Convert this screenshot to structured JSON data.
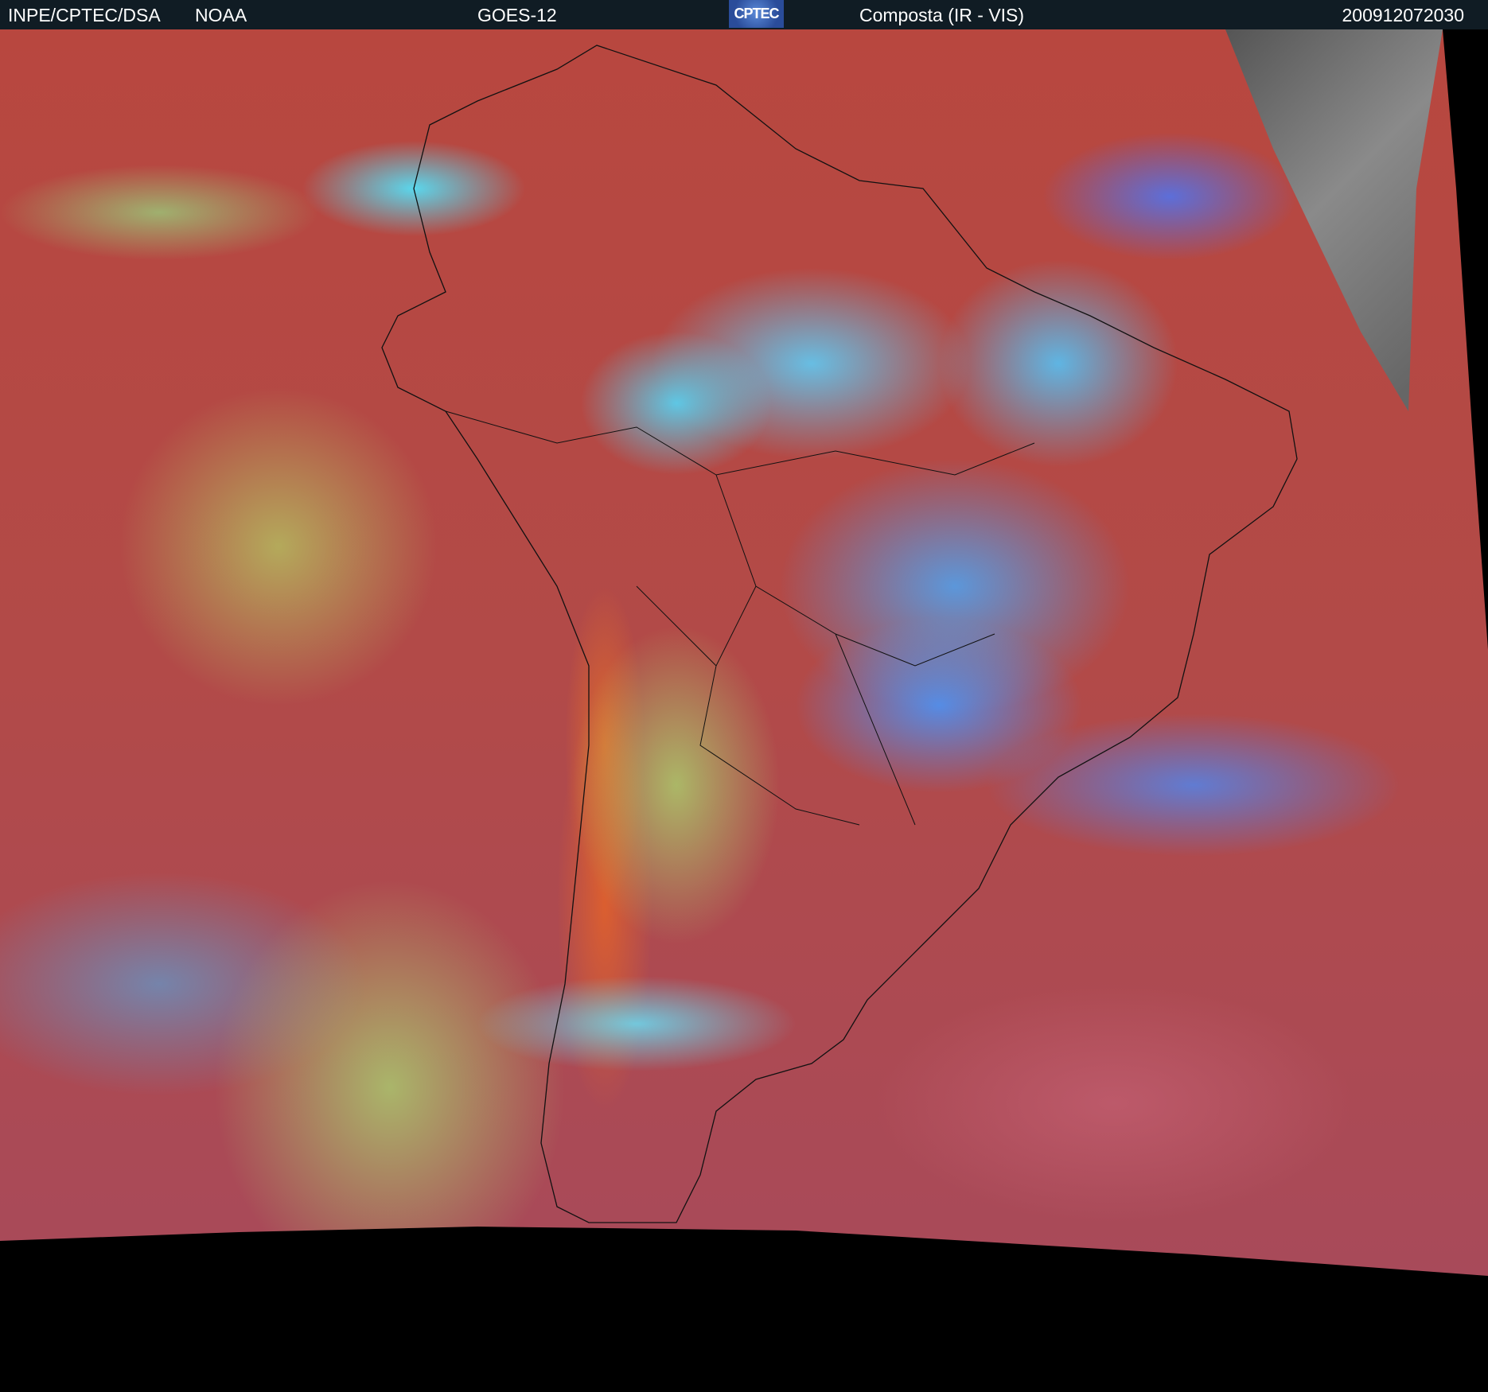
{
  "header": {
    "source": "INPE/CPTEC/DSA",
    "agency": "NOAA",
    "satellite": "GOES-12",
    "logo_text": "CPTEC",
    "product": "Composta (IR - VIS)",
    "timestamp": "200912072030"
  },
  "colors": {
    "header_bg": "#101c24",
    "ocean_red": "#b8473f",
    "cloud_cyan": "#50e6ff",
    "cloud_blue": "#4690ff"
  }
}
